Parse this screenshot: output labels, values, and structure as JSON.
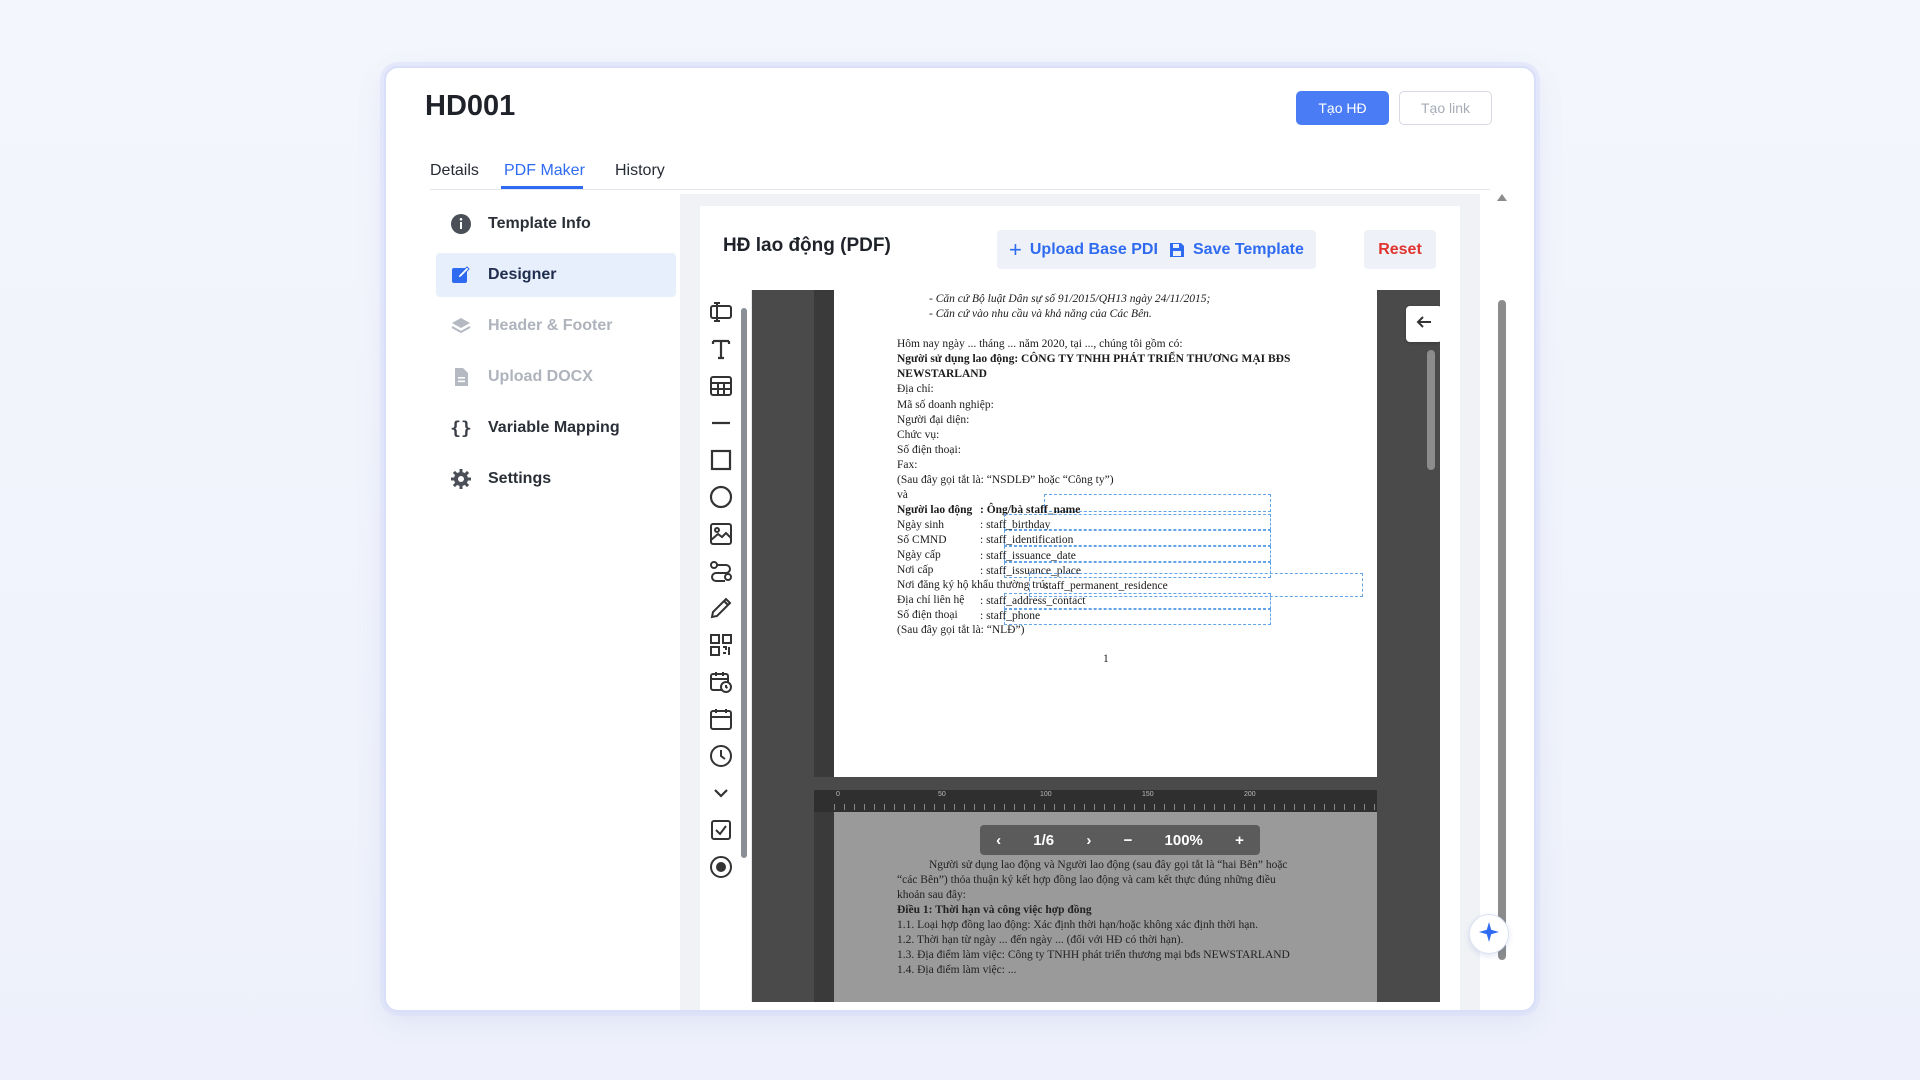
{
  "header": {
    "title": "HD001",
    "primary_button": "Tạo HĐ",
    "secondary_button": "Tạo link"
  },
  "tabs": [
    {
      "label": "Details",
      "active": false
    },
    {
      "label": "PDF Maker",
      "active": true
    },
    {
      "label": "History",
      "active": false
    }
  ],
  "sidebar": {
    "items": [
      {
        "label": "Template Info",
        "icon": "info-icon",
        "state": "normal"
      },
      {
        "label": "Designer",
        "icon": "edit-icon",
        "state": "active"
      },
      {
        "label": "Header & Footer",
        "icon": "layers-icon",
        "state": "disabled"
      },
      {
        "label": "Upload DOCX",
        "icon": "file-icon",
        "state": "disabled"
      },
      {
        "label": "Variable Mapping",
        "icon": "braces-icon",
        "state": "normal"
      },
      {
        "label": "Settings",
        "icon": "gear-icon",
        "state": "normal"
      }
    ]
  },
  "designer": {
    "template_name": "HĐ lao động (PDF)",
    "upload_button": "Upload Base PDF",
    "save_button": "Save Template",
    "reset_button": "Reset",
    "tools": [
      "text-field-icon",
      "text-icon",
      "table-icon",
      "line-icon",
      "rectangle-icon",
      "ellipse-icon",
      "image-icon",
      "svg-icon",
      "signature-icon",
      "qrcode-icon",
      "datetime-icon",
      "date-icon",
      "time-icon",
      "select-icon",
      "checkbox-icon",
      "radio-icon"
    ]
  },
  "page1": {
    "lines": [
      "- Căn cứ Bộ luật Dân sự số 91/2015/QH13 ngày 24/11/2015;",
      "- Căn cứ vào nhu cầu và khả năng của Các Bên.",
      "Hôm nay ngày ... tháng ... năm 2020, tại ..., chúng tôi gồm có:",
      "Người sử dụng lao động: CÔNG TY TNHH PHÁT TRIỂN THƯƠNG MẠI BĐS",
      "NEWSTARLAND",
      "Địa chỉ:",
      "Mã số doanh nghiệp:",
      "Người đại diện:",
      "Chức vụ:",
      "Số điện thoại:",
      "Fax:",
      "(Sau đây gọi tắt là: “NSDLĐ” hoặc “Công ty”)",
      "và",
      "(Sau đây gọi tắt là: “NLĐ”)"
    ],
    "fields": [
      {
        "label": "Người lao động",
        "value": ": Ông/bà staff_name"
      },
      {
        "label": "Ngày sinh",
        "value": ": staff_birthday"
      },
      {
        "label": "Số CMND",
        "value": ": staff_identification"
      },
      {
        "label": "Ngày cấp",
        "value": ": staff_issuance_date"
      },
      {
        "label": "Nơi cấp",
        "value": ": staff_issuance_place"
      },
      {
        "label": "Nơi đăng ký hộ khẩu thường trú:",
        "value": "staff_permanent_residence"
      },
      {
        "label": "Địa chỉ liên hệ",
        "value": ": staff_address_contact"
      },
      {
        "label": "Số điện thoại",
        "value": ": staff_phone"
      }
    ],
    "page_number": "1"
  },
  "page2": {
    "lines": [
      "Người sử dụng lao động và Người lao động (sau đây gọi tắt là “hai Bên” hoặc",
      "“các Bên”) thỏa thuận ký kết hợp đồng lao động và cam kết thực đúng những điều",
      "khoản sau đây:",
      "Điều 1: Thời hạn và công việc hợp đồng",
      "1.1. Loại hợp đồng lao động: Xác định thời hạn/hoặc không xác định thời hạn.",
      "1.2. Thời hạn từ ngày ... đến ngày ... (đối với HĐ có thời hạn).",
      "1.3. Địa điểm làm việc: Công ty TNHH phát triển thương mại bđs NEWSTARLAND",
      "1.4. Địa điểm làm việc: ..."
    ],
    "ruler_ticks": [
      "0",
      "50",
      "100",
      "150",
      "200"
    ]
  },
  "viewer": {
    "page_indicator": "1/6",
    "zoom": "100%"
  }
}
